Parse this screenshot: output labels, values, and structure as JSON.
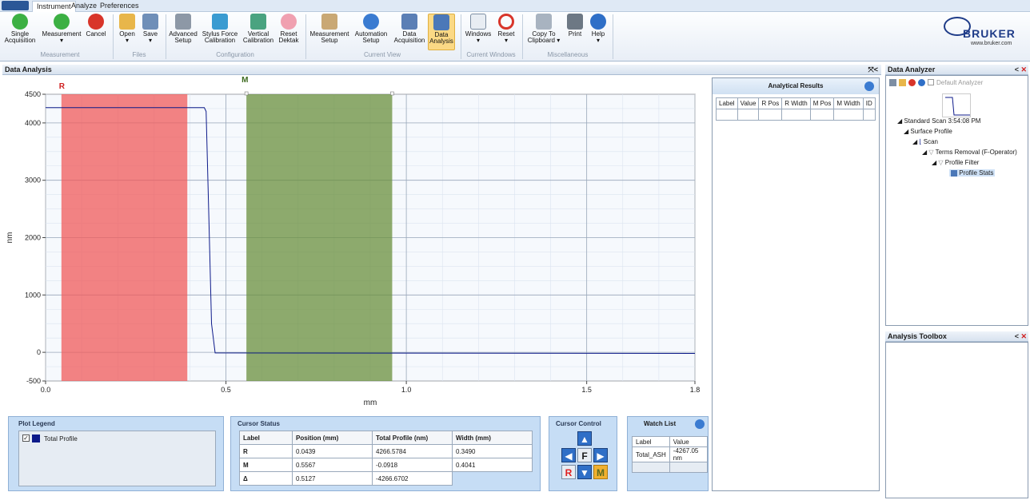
{
  "menu": {
    "tabs": [
      "Instrument",
      "Analyze",
      "Preferences"
    ]
  },
  "ribbon": {
    "buttons": [
      {
        "l1": "Single",
        "l2": "Acquisition"
      },
      {
        "l1": "Measurement",
        "l2": "▾"
      },
      {
        "l1": "Cancel",
        "l2": ""
      },
      {
        "l1": "Open",
        "l2": "▾"
      },
      {
        "l1": "Save",
        "l2": "▾"
      },
      {
        "l1": "Advanced",
        "l2": "Setup"
      },
      {
        "l1": "Stylus Force",
        "l2": "Calibration"
      },
      {
        "l1": "Vertical",
        "l2": "Calibration"
      },
      {
        "l1": "Reset",
        "l2": "Dektak"
      },
      {
        "l1": "Measurement",
        "l2": "Setup"
      },
      {
        "l1": "Automation",
        "l2": "Setup"
      },
      {
        "l1": "Data",
        "l2": "Acquisition"
      },
      {
        "l1": "Data",
        "l2": "Analysis"
      },
      {
        "l1": "Windows",
        "l2": "▾"
      },
      {
        "l1": "Reset",
        "l2": "▾"
      },
      {
        "l1": "Copy To",
        "l2": "Clipboard ▾"
      },
      {
        "l1": "Print",
        "l2": ""
      },
      {
        "l1": "Help",
        "l2": "▾"
      }
    ],
    "groups": [
      "Measurement",
      "Files",
      "Configuration",
      "Current View",
      "Current Windows",
      "Miscellaneous"
    ],
    "logo": "BRUKER",
    "logo_url": "www.bruker.com"
  },
  "data_analysis": {
    "title": "Data Analysis",
    "title_icons": "⤧<"
  },
  "chart_data": {
    "type": "line",
    "xlabel": "mm",
    "ylabel": "nm",
    "xlim": [
      0,
      1.8
    ],
    "ylim": [
      -500,
      4500
    ],
    "xticks": [
      "0.0",
      "0.5",
      "1.0",
      "1.5",
      "1.8"
    ],
    "yticks": [
      "4500",
      "4000",
      "3000",
      "2000",
      "1000",
      "0",
      "-500"
    ],
    "series": [
      {
        "name": "Total Profile",
        "x": [
          0,
          0.44,
          0.445,
          0.452,
          0.46,
          0.47,
          1.8
        ],
        "y": [
          4266,
          4266,
          4200,
          2500,
          500,
          -10,
          -20
        ]
      }
    ],
    "cursor_r": {
      "label": "R",
      "start": 0.0439,
      "end": 0.3929,
      "color": "#f05a5a"
    },
    "cursor_m": {
      "label": "M",
      "start": 0.5567,
      "end": 0.9608,
      "color": "#6a8f3c"
    }
  },
  "analytical_results": {
    "title": "Analytical Results",
    "headers": [
      "Label",
      "Value",
      "R Pos",
      "R Width",
      "M Pos",
      "M Width",
      "ID"
    ]
  },
  "plot_legend": {
    "title": "Plot Legend",
    "item": "Total Profile",
    "color": "#0d1a8a"
  },
  "cursor_status": {
    "title": "Cursor Status",
    "headers": [
      "Label",
      "Position (mm)",
      "Total Profile (nm)",
      "Width (mm)"
    ],
    "rows": [
      [
        "R",
        "0.0439",
        "4266.5784",
        "0.3490"
      ],
      [
        "M",
        "0.5567",
        "-0.0918",
        "0.4041"
      ],
      [
        "Δ",
        "0.5127",
        "-4266.6702",
        ""
      ]
    ]
  },
  "cursor_control": {
    "title": "Cursor Control",
    "f": "F",
    "r": "R",
    "m": "M"
  },
  "watch_list": {
    "title": "Watch List",
    "headers": [
      "Label",
      "Value"
    ],
    "row": [
      "Total_ASH",
      "-4267.05 nm"
    ]
  },
  "data_analyzer": {
    "title": "Data Analyzer",
    "default": "Default Analyzer",
    "tree": [
      "Standard Scan 3:54:08 PM",
      "Surface Profile",
      "Scan",
      "Terms Removal (F-Operator)",
      "Profile Filter",
      "Profile Stats"
    ]
  },
  "analysis_toolbox": {
    "title": "Analysis Toolbox"
  }
}
